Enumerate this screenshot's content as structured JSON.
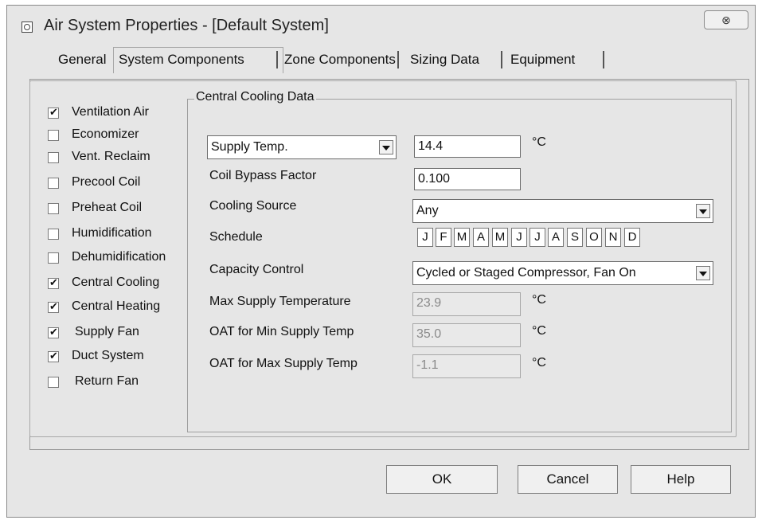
{
  "window": {
    "title": "Air System Properties - [Default System]",
    "close_glyph": "⊗"
  },
  "tabs": [
    {
      "label": "General"
    },
    {
      "label": "System Components"
    },
    {
      "label": "Zone Components"
    },
    {
      "label": "Sizing Data"
    },
    {
      "label": "Equipment"
    }
  ],
  "components": [
    {
      "label": "Ventilation Air",
      "checked": true
    },
    {
      "label": "Economizer",
      "checked": false
    },
    {
      "label": "Vent. Reclaim",
      "checked": false
    },
    {
      "label": "Precool Coil",
      "checked": false
    },
    {
      "label": "Preheat Coil",
      "checked": false
    },
    {
      "label": "Humidification",
      "checked": false
    },
    {
      "label": "Dehumidification",
      "checked": false
    },
    {
      "label": "Central Cooling",
      "checked": true
    },
    {
      "label": "Central Heating",
      "checked": true
    },
    {
      "label": "Supply Fan",
      "checked": true
    },
    {
      "label": "Duct System",
      "checked": true
    },
    {
      "label": "Return Fan",
      "checked": false
    }
  ],
  "cooling": {
    "group_title": "Central Cooling Data",
    "supply_temp_select": "Supply Temp.",
    "supply_temp_value": "14.4",
    "unit_c": "°C",
    "coil_bypass_label": "Coil Bypass Factor",
    "coil_bypass_value": "0.100",
    "cooling_source_label": "Cooling Source",
    "cooling_source_value": "Any",
    "schedule_label": "Schedule",
    "months": [
      "J",
      "F",
      "M",
      "A",
      "M",
      "J",
      "J",
      "A",
      "S",
      "O",
      "N",
      "D"
    ],
    "capacity_control_label": "Capacity Control",
    "capacity_control_value": "Cycled or Staged Compressor, Fan On",
    "max_supply_temp_label": "Max Supply Temperature",
    "max_supply_temp_value": "23.9",
    "oat_min_label": "OAT for Min Supply Temp",
    "oat_min_value": "35.0",
    "oat_max_label": "OAT for Max Supply Temp",
    "oat_max_value": "-1.1"
  },
  "buttons": {
    "ok": "OK",
    "cancel": "Cancel",
    "help": "Help"
  }
}
